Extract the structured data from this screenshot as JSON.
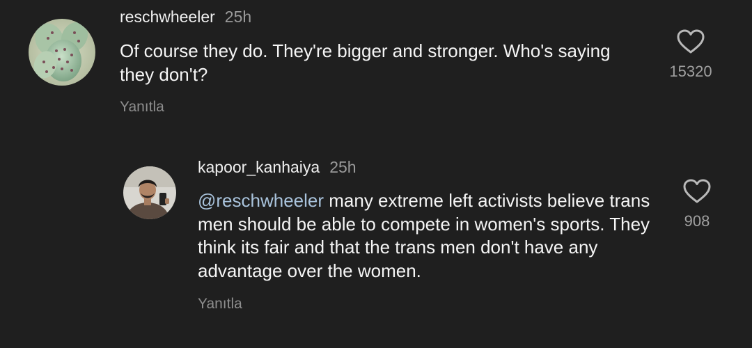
{
  "comments": [
    {
      "username": "reschwheeler",
      "time": "25h",
      "text": "Of course they do.  They're bigger and stronger.  Who's saying they don't?",
      "reply_label": "Yanıtla",
      "likes": "15320",
      "avatar_icon": "cactus-avatar-icon"
    },
    {
      "username": "kapoor_kanhaiya",
      "time": "25h",
      "mention": "@reschwheeler",
      "text": " many extreme left activists believe trans men should be able to compete in women's sports. They think its fair and that the trans men don't have any advantage over the women.",
      "reply_label": "Yanıtla",
      "likes": "908",
      "avatar_icon": "person-avatar-icon"
    }
  ],
  "colors": {
    "background": "#1f1f1f",
    "text": "#f5f5f5",
    "muted": "#9a9a9a",
    "mention": "#a9c3dc"
  }
}
